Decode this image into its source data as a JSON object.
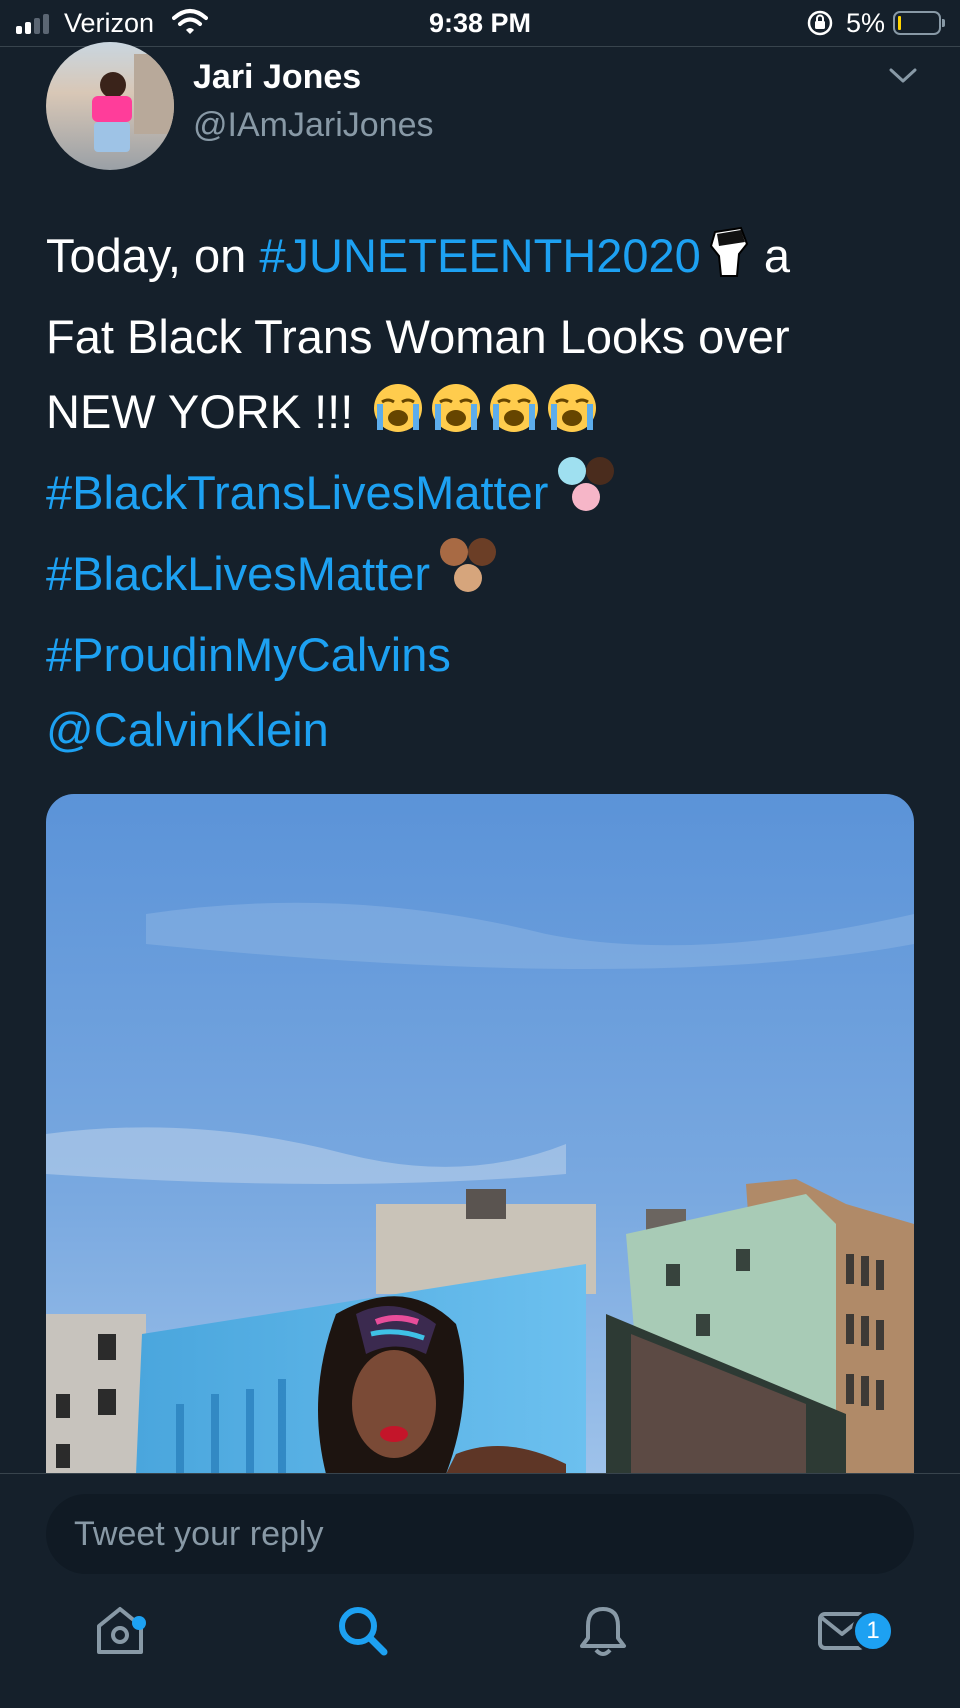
{
  "status_bar": {
    "carrier": "Verizon",
    "time": "9:38 PM",
    "battery_percent": "5%"
  },
  "tweet": {
    "author_name": "Jari Jones",
    "author_handle": "@IAmJariJones",
    "text_lines": [
      {
        "plain": "Today, on ",
        "link": "#JUNETEENTH2020",
        "after": " a"
      },
      {
        "plain": "Fat Black Trans Woman Looks over"
      },
      {
        "plain": "NEW YORK !!! "
      },
      {
        "link": "#BlackTransLivesMatter"
      },
      {
        "link": "#BlackLivesMatter"
      },
      {
        "link": "#ProudinMyCalvins"
      },
      {
        "link": "@CalvinKlein"
      }
    ]
  },
  "reply": {
    "placeholder": "Tweet your reply"
  },
  "tab_bar": {
    "messages_badge": "1"
  },
  "colors": {
    "background": "#15202b",
    "link": "#1da1f2",
    "secondary_text": "#8899a6",
    "divider": "#38444d"
  },
  "icons": [
    "signal-icon",
    "wifi-icon",
    "rotation-lock-icon",
    "battery-icon",
    "chevron-down-icon",
    "fist-emoji",
    "crying-face-emoji",
    "fists-emoji",
    "home-icon",
    "search-icon",
    "notifications-icon",
    "messages-icon"
  ]
}
